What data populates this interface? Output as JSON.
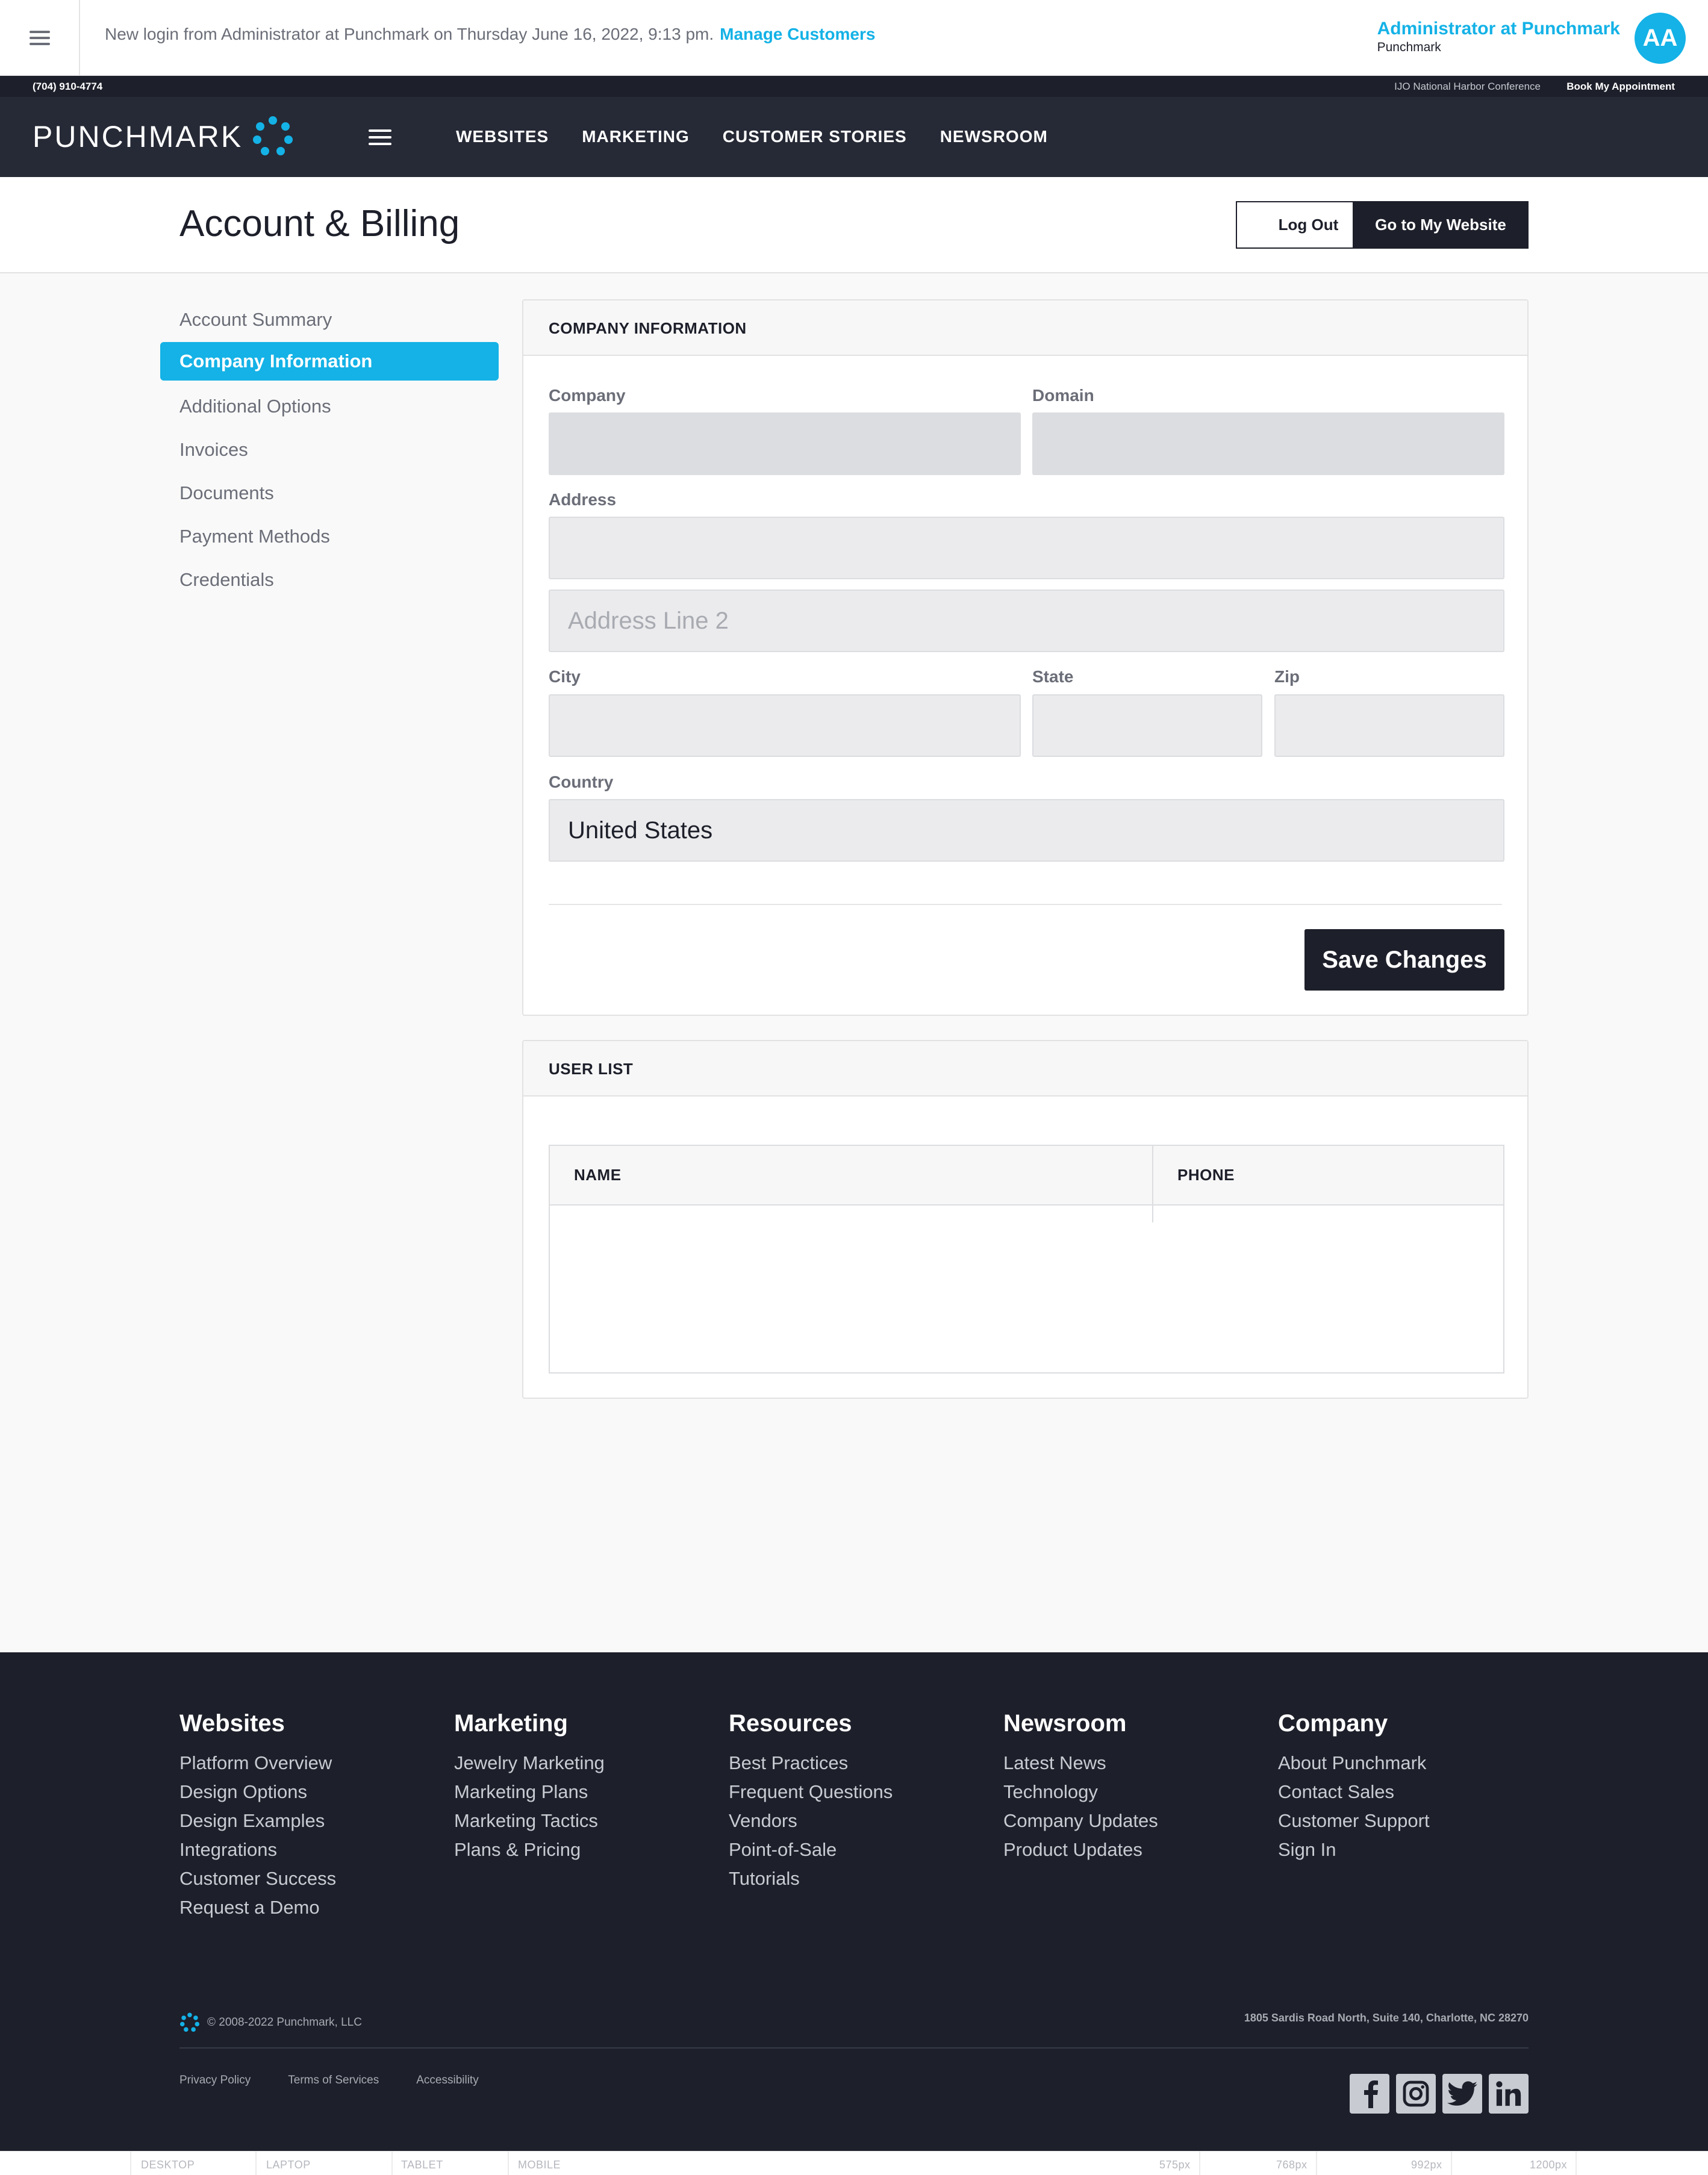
{
  "admin_bar": {
    "message": "New login from Administrator at Punchmark on Thursday June 16, 2022, 9:13 pm.",
    "manage_link": "Manage Customers",
    "user_name": "Administrator at Punchmark",
    "user_org": "Punchmark",
    "avatar_initials": "AA"
  },
  "utility_bar": {
    "phone": "(704) 910-4774",
    "conference": "IJO National Harbor Conference",
    "book": "Book My Appointment"
  },
  "nav": {
    "logo": "PUNCHMARK",
    "links": [
      "WEBSITES",
      "MARKETING",
      "CUSTOMER STORIES",
      "NEWSROOM"
    ]
  },
  "page": {
    "title": "Account & Billing",
    "logout": "Log Out",
    "goto_site": "Go to My Website"
  },
  "sidebar": {
    "items": [
      {
        "label": "Account Summary"
      },
      {
        "label": "Company Information"
      },
      {
        "label": "Additional Options"
      },
      {
        "label": "Invoices"
      },
      {
        "label": "Documents"
      },
      {
        "label": "Payment Methods"
      },
      {
        "label": "Credentials"
      }
    ]
  },
  "company_form": {
    "heading": "COMPANY INFORMATION",
    "company_label": "Company",
    "company_value": "",
    "domain_label": "Domain",
    "domain_value": "",
    "address_label": "Address",
    "address_value": "",
    "address2_placeholder": "Address Line 2",
    "city_label": "City",
    "state_label": "State",
    "zip_label": "Zip",
    "country_label": "Country",
    "country_value": "United States",
    "save": "Save Changes"
  },
  "user_list": {
    "heading": "USER LIST",
    "columns": [
      "NAME",
      "PHONE"
    ]
  },
  "footer": {
    "columns": [
      {
        "title": "Websites",
        "links": [
          "Platform Overview",
          "Design Options",
          "Design Examples",
          "Integrations",
          "Customer Success",
          "Request a Demo"
        ]
      },
      {
        "title": "Marketing",
        "links": [
          "Jewelry Marketing",
          "Marketing Plans",
          "Marketing Tactics",
          "Plans & Pricing"
        ]
      },
      {
        "title": "Resources",
        "links": [
          "Best Practices",
          "Frequent Questions",
          "Vendors",
          "Point-of-Sale",
          "Tutorials"
        ]
      },
      {
        "title": "Newsroom",
        "links": [
          "Latest News",
          "Technology",
          "Company Updates",
          "Product Updates"
        ]
      },
      {
        "title": "Company",
        "links": [
          "About Punchmark",
          "Contact Sales",
          "Customer Support",
          "Sign In"
        ]
      }
    ],
    "copyright": "© 2008-2022 Punchmark, LLC",
    "address": "1805 Sardis Road North, Suite 140, Charlotte, NC 28270",
    "legal_links": [
      "Privacy Policy",
      "Terms of Services",
      "Accessibility"
    ],
    "social": [
      "facebook-icon",
      "instagram-icon",
      "twitter-icon",
      "linkedin-icon"
    ]
  },
  "ruler": {
    "labels": [
      "DESKTOP",
      "LAPTOP",
      "TABLET",
      "MOBILE"
    ],
    "widths": [
      "575px",
      "768px",
      "992px",
      "1200px"
    ]
  },
  "colors": {
    "accent": "#14b2e6",
    "dark": "#1d1f2a",
    "nav": "#262a36"
  }
}
